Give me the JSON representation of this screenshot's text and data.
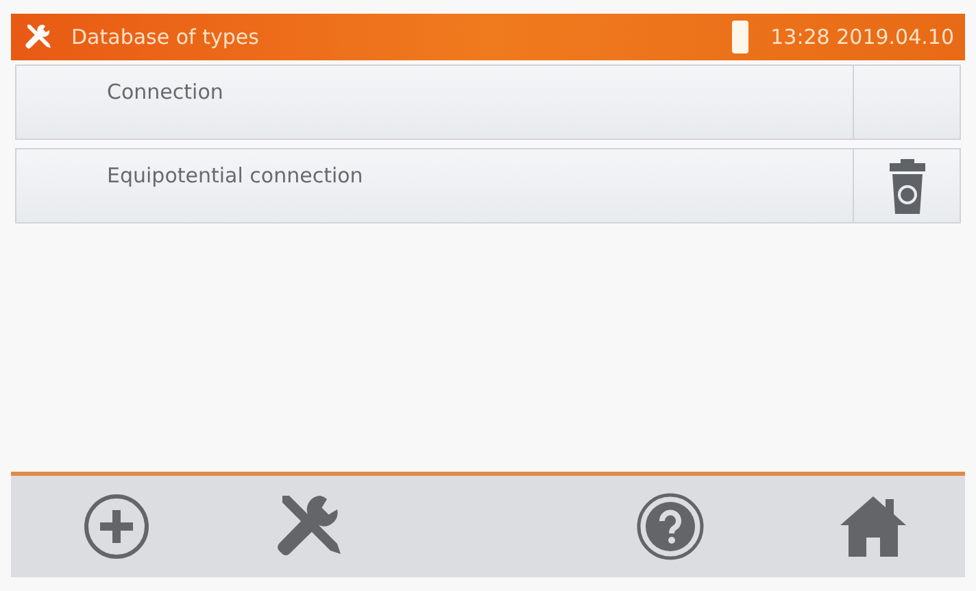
{
  "header": {
    "title": "Database of types",
    "datetime": "13:28 2019.04.10"
  },
  "rows": [
    {
      "label": "Connection",
      "deletable": false
    },
    {
      "label": "Equipotential connection",
      "deletable": true
    }
  ]
}
